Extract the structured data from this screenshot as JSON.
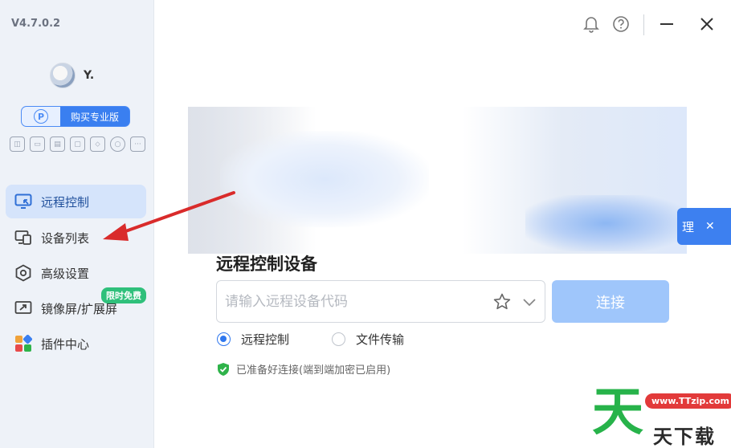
{
  "app": {
    "version": "V4.7.0.2"
  },
  "user": {
    "name": "Y."
  },
  "sidebar": {
    "pro_button_icon_letter": "P",
    "pro_button_label": "购买专业版",
    "tools": [
      {
        "icon": "gamepad-icon",
        "glyph": "◫"
      },
      {
        "icon": "screen-icon",
        "glyph": "▭"
      },
      {
        "icon": "folder-icon",
        "glyph": "▤"
      },
      {
        "icon": "window-icon",
        "glyph": "▢"
      },
      {
        "icon": "rocket-icon",
        "glyph": "⬦"
      },
      {
        "icon": "circle-icon",
        "glyph": "○"
      },
      {
        "icon": "more-icon",
        "glyph": "···"
      }
    ],
    "items": [
      {
        "label": "远程控制",
        "icon": "remote-control-icon",
        "active": true
      },
      {
        "label": "设备列表",
        "icon": "device-list-icon",
        "active": false
      },
      {
        "label": "高级设置",
        "icon": "advanced-settings-icon",
        "active": false
      },
      {
        "label": "镜像屏/扩展屏",
        "icon": "mirror-screen-icon",
        "active": false,
        "badge": "限时免费"
      },
      {
        "label": "插件中心",
        "icon": "plugin-center-icon",
        "active": false
      }
    ]
  },
  "banner": {
    "tail_text": "理"
  },
  "connect": {
    "title": "远程控制设备",
    "input_placeholder": "请输入远程设备代码",
    "connect_label": "连接",
    "modes": [
      {
        "label": "远程控制",
        "selected": true
      },
      {
        "label": "文件传输",
        "selected": false
      }
    ],
    "status_text": "已准备好连接(端到端加密已启用)"
  },
  "watermark": {
    "big_char": "天",
    "url": "www.TTzip.com",
    "small_text": "天下载"
  },
  "colors": {
    "accent": "#3a7ff0",
    "active_bg": "#d5e4fb",
    "connect_btn": "#9fc6fb",
    "success": "#2fb34a",
    "arrow": "#d92b2b"
  }
}
